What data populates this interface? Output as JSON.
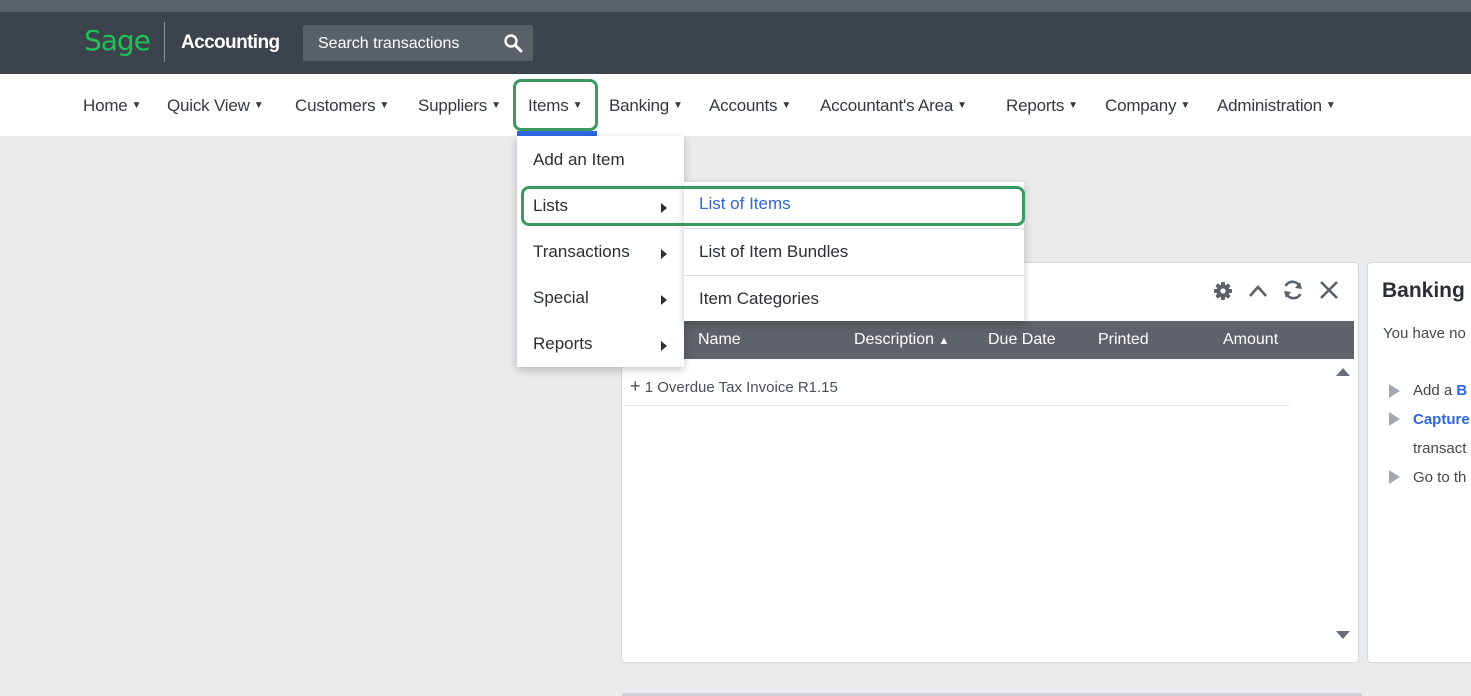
{
  "colors": {
    "brand_green": "#1fc156",
    "topbar": "#3d434c",
    "accent_blue": "#2f66e3",
    "highlight_green": "#3b9a5e"
  },
  "header": {
    "logo": "Sage",
    "product": "Accounting",
    "search_placeholder": "Search transactions"
  },
  "nav": {
    "items": [
      {
        "label": "Home"
      },
      {
        "label": "Quick View"
      },
      {
        "label": "Customers"
      },
      {
        "label": "Suppliers"
      },
      {
        "label": "Items"
      },
      {
        "label": "Banking"
      },
      {
        "label": "Accounts"
      },
      {
        "label": "Accountant's Area"
      },
      {
        "label": "Reports"
      },
      {
        "label": "Company"
      },
      {
        "label": "Administration"
      }
    ]
  },
  "items_menu": {
    "items": [
      {
        "label": "Add an Item"
      },
      {
        "label": "Lists"
      },
      {
        "label": "Transactions"
      },
      {
        "label": "Special"
      },
      {
        "label": "Reports"
      }
    ]
  },
  "lists_submenu": {
    "items": [
      {
        "label": "List of Items"
      },
      {
        "label": "List of Item Bundles"
      },
      {
        "label": "Item Categories"
      }
    ]
  },
  "invoices_panel": {
    "columns": [
      "Name",
      "Description",
      "Due Date",
      "Printed",
      "Amount"
    ],
    "sorted_column": "Description",
    "rows": [
      "1 Overdue Tax Invoice R1.15"
    ]
  },
  "banking_panel": {
    "title": "Banking",
    "text": "You have no",
    "line1_prefix": "Add a",
    "line1_link": "B",
    "line2_link": "Capture",
    "line2_cont": "transact",
    "line3": "Go to th"
  }
}
